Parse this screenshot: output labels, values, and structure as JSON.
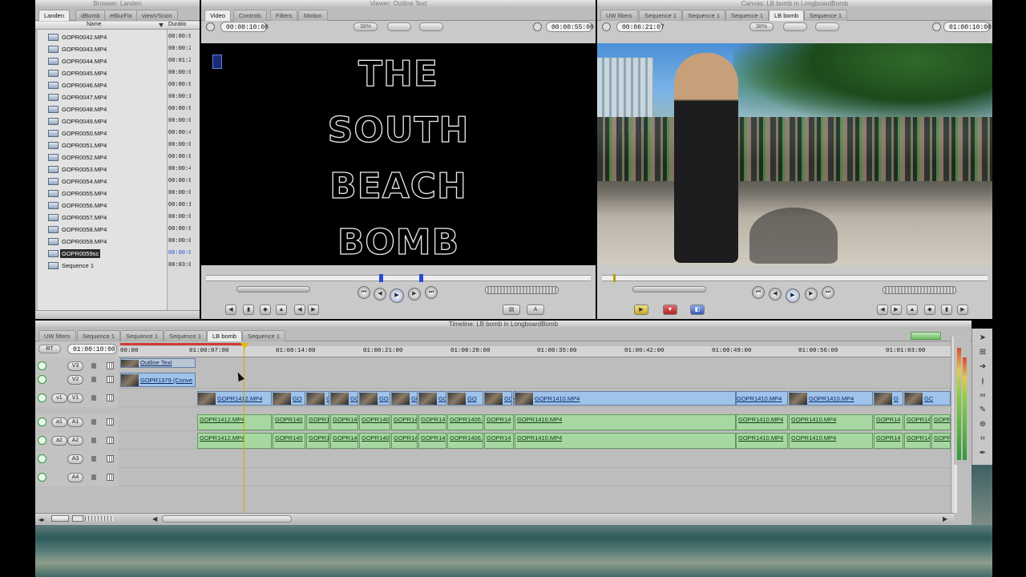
{
  "browser": {
    "title": "Browser: Landen",
    "tabs": [
      "Landen",
      "dBomb",
      "eBlurFix",
      "viewVSnon"
    ],
    "columns": {
      "name": "Name",
      "duration": "Duratio"
    },
    "items": [
      {
        "name": "GOPR0042.MP4",
        "dur": "00:00:0"
      },
      {
        "name": "GOPR0043.MP4",
        "dur": "00:00:2"
      },
      {
        "name": "GOPR0044.MP4",
        "dur": "00:01:2"
      },
      {
        "name": "GOPR0045.MP4",
        "dur": "00:00:0"
      },
      {
        "name": "GOPR0046.MP4",
        "dur": "00:00:0"
      },
      {
        "name": "GOPR0047.MP4",
        "dur": "00:00:1"
      },
      {
        "name": "GOPR0048.MP4",
        "dur": "00:00:0"
      },
      {
        "name": "GOPR0049.MP4",
        "dur": "00:00:0"
      },
      {
        "name": "GOPR0050.MP4",
        "dur": "00:00:4"
      },
      {
        "name": "GOPR0051.MP4",
        "dur": "00:00:0"
      },
      {
        "name": "GOPR0052.MP4",
        "dur": "00:00:0"
      },
      {
        "name": "GOPR0053.MP4",
        "dur": "00:00:4"
      },
      {
        "name": "GOPR0054.MP4",
        "dur": "00:00:0"
      },
      {
        "name": "GOPR0055.MP4",
        "dur": "00:00:0"
      },
      {
        "name": "GOPR0056.MP4",
        "dur": "00:00:1"
      },
      {
        "name": "GOPR0057.MP4",
        "dur": "00:00:0"
      },
      {
        "name": "GOPR0058.MP4",
        "dur": "00:00:0"
      },
      {
        "name": "GOPR0059.MP4",
        "dur": "00:00:0"
      },
      {
        "name": "GOPR0059sc",
        "dur": "00:00:0"
      },
      {
        "name": "Sequence 1",
        "dur": "00:03:0"
      }
    ]
  },
  "viewer": {
    "title": "Viewer: Outline Text",
    "tabs": [
      "Video",
      "Controls",
      "Filters",
      "Motion"
    ],
    "duration_tc": "00:00:10:00",
    "zoom": "38%",
    "current_tc": "00:00:55:00",
    "title_lines": [
      "THE",
      "SOUTH",
      "BEACH",
      "BOMB"
    ]
  },
  "canvas": {
    "title": "Canvas: LB bomb in LongboardBomb",
    "tabs": [
      "UW filters",
      "Sequence 1",
      "Sequence 1",
      "Sequence 1",
      "LB bomb",
      "Sequence 1"
    ],
    "duration_tc": "00:06:21:07",
    "zoom": "38%",
    "current_tc": "01:00:10:00"
  },
  "timeline": {
    "title": "Timeline: LB bomb in LongboardBomb",
    "tabs": [
      "UW filters",
      "Sequence 1",
      "Sequence 1",
      "Sequence 1",
      "LB bomb",
      "Sequence 1"
    ],
    "rt": "RT",
    "playhead_tc": "01:00:10:00",
    "ruler": [
      "00:00",
      "01:00:07:00",
      "01:00:14:00",
      "01:00:21:00",
      "01:00:28:00",
      "01:00:35:00",
      "01:00:42:00",
      "01:00:49:00",
      "01:00:56:00",
      "01:01:03:00"
    ],
    "tracks": {
      "v3": "V3",
      "v2": "V2",
      "v1src": "v1",
      "v1": "V1",
      "a1src": "a1",
      "a1": "A1",
      "a2src": "a2",
      "a2": "A2",
      "a3": "A3",
      "a4": "A4"
    },
    "v3_clip": "Outline Text",
    "v2_clip": "GOPR1379 (Conve",
    "v1_clips": [
      "GOPR1412.MP4",
      "GO",
      "GO",
      "GO",
      "GO",
      "GO",
      "GO",
      "GO",
      "GOPF",
      "GC",
      "GOPR1410.MP4",
      "GOPR1410.MP4",
      "GOPR1410.MP4",
      "G",
      "GC"
    ],
    "a_clips": [
      "GOPR1412.MP4",
      "GOPR140",
      "GOPR1",
      "GOPR14(",
      "GOPR140",
      "GOPR14",
      "GOPR14",
      "GOPR1406.",
      "GOPR14",
      "GOPR1410.MP4",
      "GOPR1410.MP4",
      "GOPR1410.MP4",
      "GOPR14",
      "GOPR14",
      "GOPR"
    ]
  },
  "colors": {
    "video_clip": "#9fc3ea",
    "audio_clip": "#a8d8a2",
    "record": "#2e9b3d",
    "in_out_marker": "#2a4bd8"
  }
}
